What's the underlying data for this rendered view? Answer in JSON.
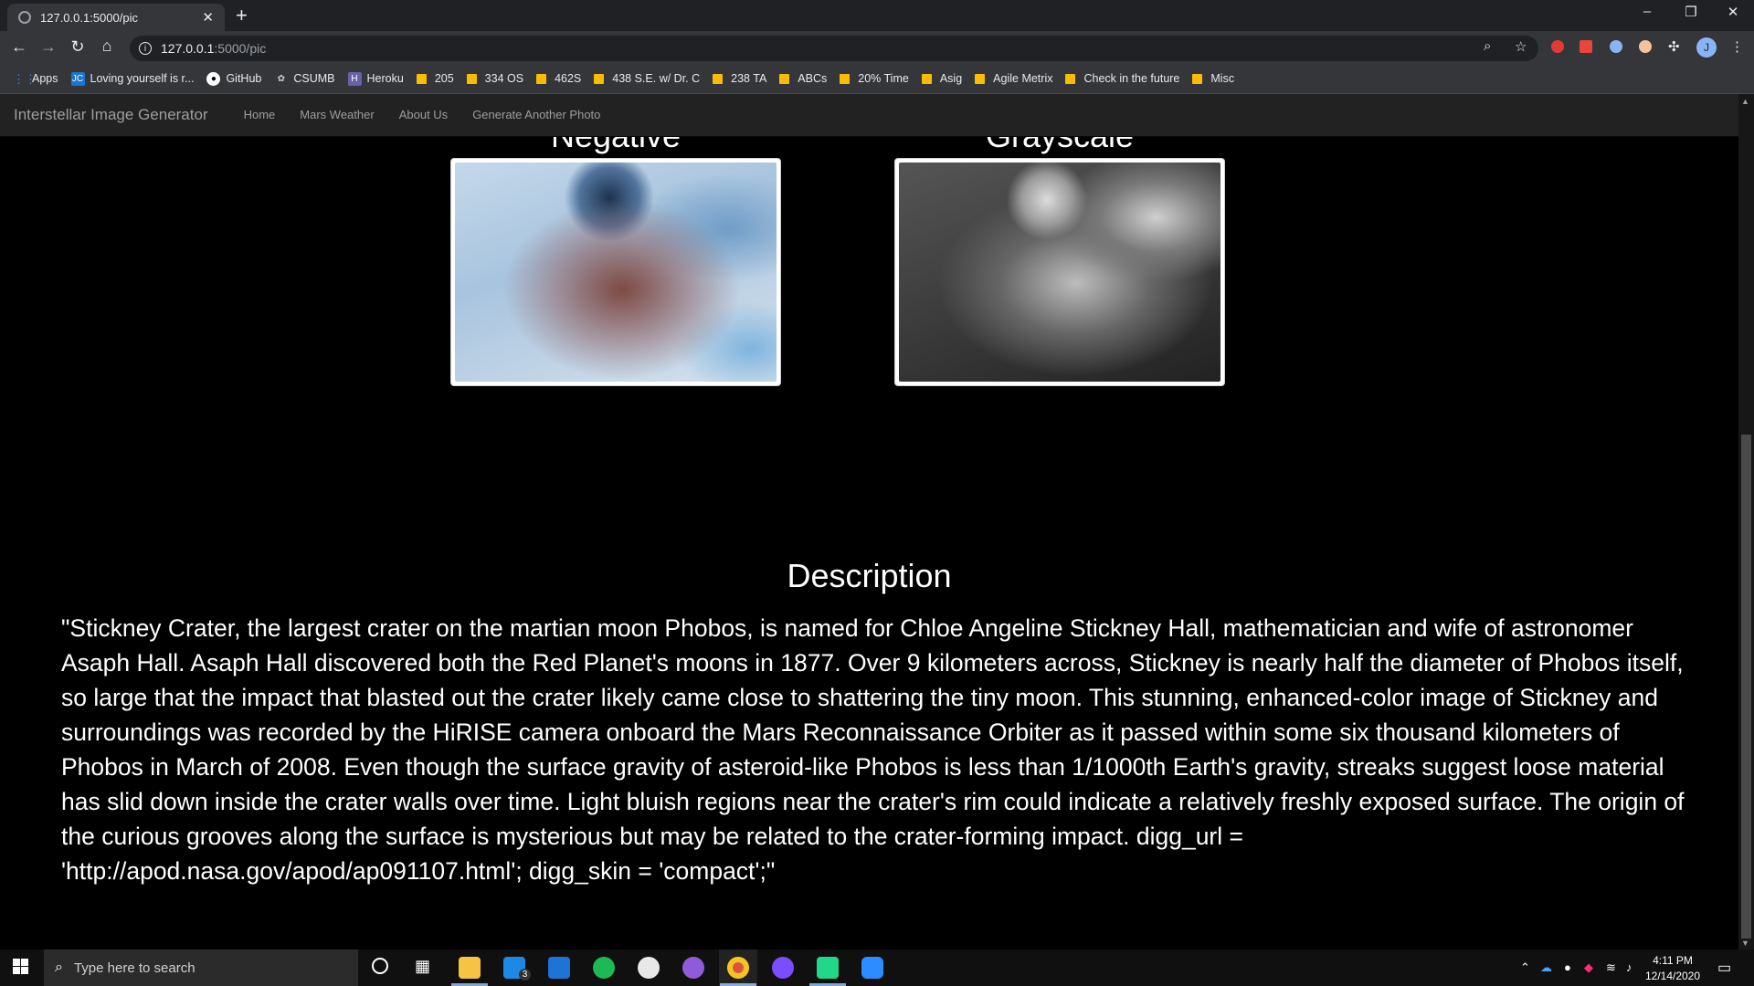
{
  "browser": {
    "tab_title": "127.0.0.1:5000/pic",
    "new_tab": "+",
    "url_host": "127.0.0.1",
    "url_path": ":5000/pic",
    "window_controls": [
      "–",
      "❐",
      "✕"
    ]
  },
  "bookmarks": [
    {
      "label": "Apps",
      "icon": "apps-grid-icon"
    },
    {
      "label": "Loving yourself is r...",
      "icon": "jc-icon"
    },
    {
      "label": "GitHub",
      "icon": "github-icon"
    },
    {
      "label": "CSUMB",
      "icon": "csumb-icon"
    },
    {
      "label": "Heroku",
      "icon": "heroku-icon"
    },
    {
      "label": "205",
      "icon": "folder-icon"
    },
    {
      "label": "334 OS",
      "icon": "folder-icon"
    },
    {
      "label": "462S",
      "icon": "folder-icon"
    },
    {
      "label": "438 S.E. w/ Dr. C",
      "icon": "folder-icon"
    },
    {
      "label": "238 TA",
      "icon": "folder-icon"
    },
    {
      "label": "ABCs",
      "icon": "folder-icon"
    },
    {
      "label": "20% Time",
      "icon": "folder-icon"
    },
    {
      "label": "Asig",
      "icon": "folder-icon"
    },
    {
      "label": "Agile Metrix",
      "icon": "folder-icon"
    },
    {
      "label": "Check in the future",
      "icon": "folder-icon"
    },
    {
      "label": "Misc",
      "icon": "folder-icon"
    }
  ],
  "site_nav": {
    "brand": "Interstellar Image Generator",
    "links": [
      "Home",
      "Mars Weather",
      "About Us",
      "Generate Another Photo"
    ]
  },
  "images": [
    {
      "caption": "Negative"
    },
    {
      "caption": "Grayscale"
    }
  ],
  "description": {
    "heading": "Description",
    "text": "\"Stickney Crater, the largest crater on the martian moon Phobos, is named for Chloe Angeline Stickney Hall, mathematician and wife of astronomer Asaph Hall. Asaph Hall discovered both the Red Planet's moons in 1877. Over 9 kilometers across, Stickney is nearly half the diameter of Phobos itself, so large that the impact that blasted out the crater likely came close to shattering the tiny moon. This stunning, enhanced-color image of Stickney and surroundings was recorded by the HiRISE camera onboard the Mars Reconnaissance Orbiter as it passed within some six thousand kilometers of Phobos in March of 2008. Even though the surface gravity of asteroid-like Phobos is less than 1/1000th Earth's gravity, streaks suggest loose material has slid down inside the crater walls over time. Light bluish regions near the crater's rim could indicate a relatively freshly exposed surface. The origin of the curious grooves along the surface is mysterious but may be related to the crater-forming impact. digg_url = 'http://apod.nasa.gov/apod/ap091107.html'; digg_skin = 'compact';\""
  },
  "taskbar": {
    "search_placeholder": "Type here to search",
    "mail_badge": "3",
    "time": "4:11 PM",
    "date": "12/14/2020"
  },
  "colors": {
    "page_bg": "#000000",
    "navbar_bg": "#222222",
    "nav_text": "#9d9d9d",
    "chrome_dark": "#202124",
    "chrome_toolbar": "#35363a"
  }
}
